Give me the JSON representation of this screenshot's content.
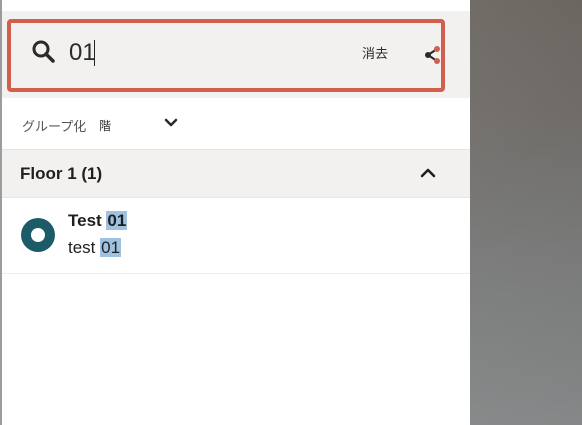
{
  "search": {
    "query": "01",
    "clear_label": "消去"
  },
  "grouping": {
    "label": "グループ化",
    "value": "階"
  },
  "floor": {
    "title": "Floor 1 (1)"
  },
  "results": [
    {
      "title_prefix": "Test ",
      "title_match": "01",
      "subtitle_prefix": "test ",
      "subtitle_match": "01"
    }
  ],
  "icons": {
    "search": "search-icon",
    "share": "share-icon",
    "group_chevron": "chevron-down-icon",
    "floor_chevron": "chevron-up-icon",
    "result_marker": "location-marker-icon"
  },
  "colors": {
    "search_border": "#d0604d",
    "highlight": "#9ec2df",
    "marker": "#1e5b68",
    "share_dot": "#d0604d"
  }
}
